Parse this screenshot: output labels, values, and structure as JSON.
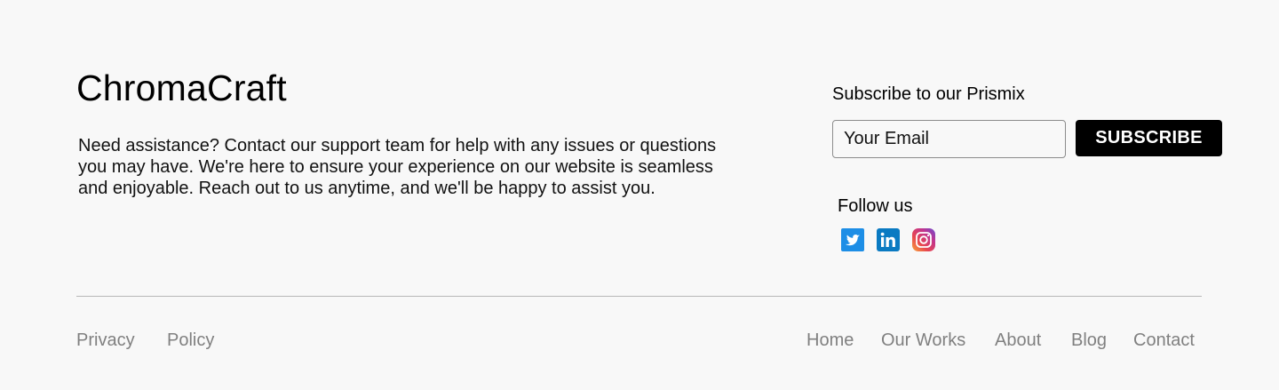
{
  "brand": {
    "name": "ChromaCraft"
  },
  "description": "Need assistance? Contact our support team for help with any issues or questions you may have. We're here to ensure your experience on our website is seamless and enjoyable. Reach out to us anytime, and we'll be happy to assist you.",
  "subscribe": {
    "title": "Subscribe to our Prismix",
    "email_placeholder": "Your Email",
    "email_value": "",
    "button_label": "SUBSCRIBE"
  },
  "follow": {
    "title": "Follow us",
    "icons": [
      "twitter-icon",
      "linkedin-icon",
      "instagram-icon"
    ]
  },
  "legal_links": [
    "Privacy",
    "Policy"
  ],
  "nav_links": [
    "Home",
    "Our Works",
    "About",
    "Blog",
    "Contact"
  ],
  "colors": {
    "background": "#f8f8f8",
    "button_bg": "#000000",
    "link_gray": "#808080",
    "divider": "#b8b8b8",
    "twitter_blue": "#1d8ee6",
    "linkedin_blue": "#0a7ac2"
  }
}
